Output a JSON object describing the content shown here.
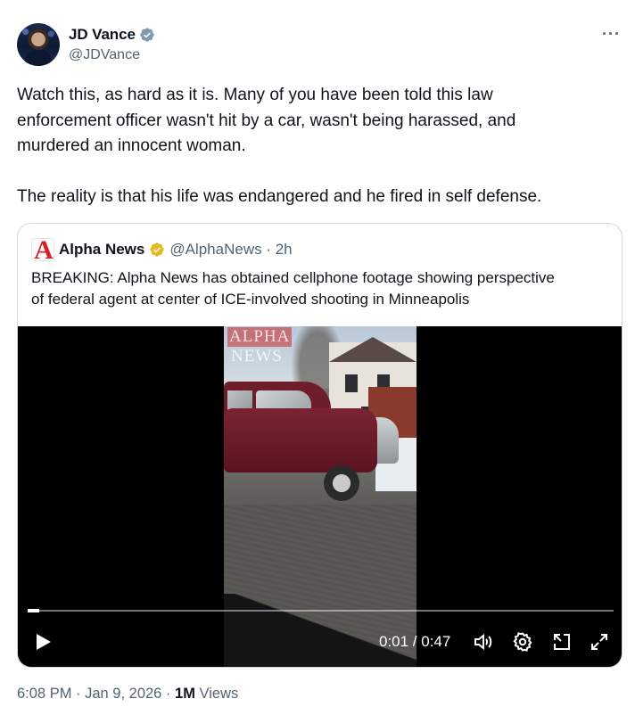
{
  "author": {
    "display_name": "JD Vance",
    "handle": "@JDVance",
    "verified_color": "#829aab",
    "avatar_icon": "avatar"
  },
  "tweet": {
    "text_lines": [
      "Watch this, as hard as it is. Many of you have been told this law",
      "enforcement officer wasn't hit by a car, wasn't being harassed, and",
      "murdered an innocent woman.",
      "The reality is that his life was endangered and he fired in self defense."
    ],
    "more_label": "···"
  },
  "quote": {
    "logo_letter": "A",
    "display_name": "Alpha News",
    "verified_color": "#e8b929",
    "handle_time": "@AlphaNews · 2h",
    "text_lines": [
      "BREAKING: Alpha News has obtained cellphone footage showing perspective",
      "of federal agent at center of ICE-involved shooting in Minneapolis"
    ],
    "video": {
      "watermark_top": "ALPHA",
      "watermark_bottom": "NEWS",
      "time": "0:01 / 0:47",
      "progress_fraction": 0.02
    }
  },
  "meta": {
    "timestamp": "6:08 PM · Jan 9, 2026 · ",
    "views_count": "1M",
    "views_label": " Views"
  },
  "colors": {
    "text_primary": "#0f1419",
    "text_secondary": "#536471",
    "border": "#cfd9de",
    "brand_red": "#d61f26"
  }
}
